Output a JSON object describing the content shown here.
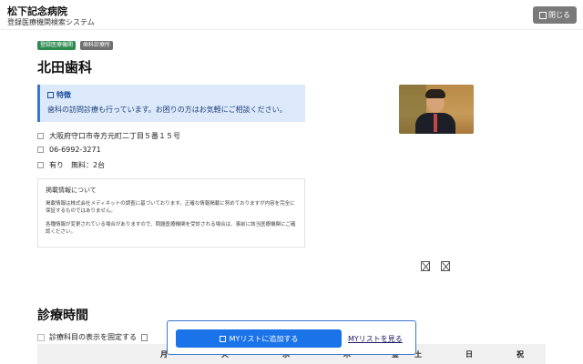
{
  "header": {
    "hospital_name": "松下記念病院",
    "system_name": "登録医療機関検索システム",
    "close_label": "閉じる"
  },
  "badges": [
    "登録医療機関",
    "歯科診療所"
  ],
  "clinic": {
    "name": "北田歯科",
    "feature_heading": "特徴",
    "feature_text": "歯科の訪問診療も行っています。お困りの方はお気軽にご相談ください。",
    "address": "大阪府守口市寺方元町二丁目５番１５号",
    "phone": "06-6992-3271",
    "parking": "有り　無料：2台"
  },
  "notice": {
    "title": "掲載情報について",
    "p1": "掲載情報は株式会社メディネットの調査に基づいております。正確な情報掲載に努めておりますが内容を完全に保証するものではありません。",
    "p2": "各種情報が変更されている場合がありますので、問題医療機関を受診される場合は、事前に該当医療機関にご確認ください。"
  },
  "schedule": {
    "title": "診療時間",
    "fix_label": "診療科目の表示を固定する",
    "days": [
      "月",
      "火",
      "水",
      "木",
      "金",
      "土",
      "日",
      "祝"
    ]
  },
  "mylist": {
    "add_label": "MYリストに追加する",
    "view_label": "MYリストを見る"
  },
  "colors": {
    "accent": "#1a73e8",
    "feature_bg": "#dce9fb",
    "badge_green": "#2e8b4f",
    "badge_gray": "#6f6f6f"
  }
}
